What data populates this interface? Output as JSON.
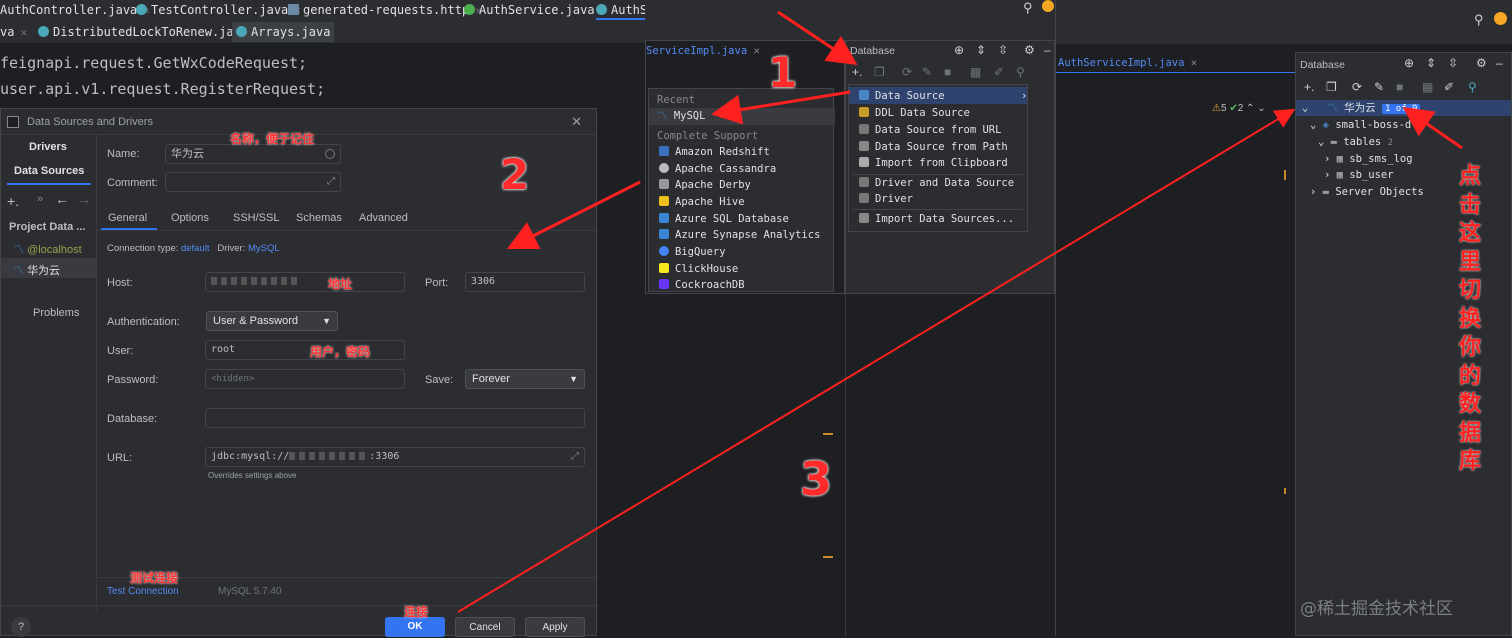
{
  "tabs_row1": [
    "AuthController.java",
    "TestController.java",
    "generated-requests.http",
    "AuthService.java",
    "AuthSe"
  ],
  "tabs_row2": [
    "va",
    "DistributedLockToRenew.java",
    "Arrays.java"
  ],
  "code_lines": [
    "feignapi.request.GetWxCodeRequest;",
    "user.api.v1.request.RegisterRequest;"
  ],
  "dialog": {
    "title": "Data Sources and Drivers",
    "side_tabs": [
      "Drivers",
      "Data Sources"
    ],
    "project_label": "Project Data ...",
    "sources": [
      "@localhost",
      "华为云"
    ],
    "problems": "Problems",
    "name_label": "Name:",
    "name_value": "华为云",
    "comment_label": "Comment:",
    "tabs": [
      "General",
      "Options",
      "SSH/SSL",
      "Schemas",
      "Advanced"
    ],
    "conn_type_label": "Connection type:",
    "conn_type": "default",
    "driver_label": "Driver:",
    "driver": "MySQL",
    "host_label": "Host:",
    "port_label": "Port:",
    "port": "3306",
    "auth_label": "Authentication:",
    "auth": "User & Password",
    "user_label": "User:",
    "user": "root",
    "password_label": "Password:",
    "password": "<hidden>",
    "save_label": "Save:",
    "save": "Forever",
    "database_label": "Database:",
    "url_label": "URL:",
    "url_prefix": "jdbc:mysql://",
    "url_suffix": ":3306",
    "url_note": "Overrides settings above",
    "test_connection": "Test Connection",
    "mysql_version": "MySQL 5.7.40",
    "ok": "OK",
    "cancel": "Cancel",
    "apply": "Apply",
    "help": "?"
  },
  "annotations": {
    "name": "名称，便于记住",
    "host": "地址",
    "user": "用户，密码",
    "test": "测试连接",
    "ok": "连接",
    "num1": "1",
    "num2": "2",
    "num3": "3",
    "vertical": [
      "点",
      "击",
      "这",
      "里",
      "切",
      "换",
      "你",
      "的",
      "数",
      "据",
      "库"
    ]
  },
  "mid_panel": {
    "editor_tab": "ServiceImpl.java",
    "recent_label": "Recent",
    "recent_item": "MySQL",
    "complete_label": "Complete Support",
    "items": [
      "Amazon Redshift",
      "Apache Cassandra",
      "Apache Derby",
      "Apache Hive",
      "Azure SQL Database",
      "Azure Synapse Analytics",
      "BigQuery",
      "ClickHouse",
      "CockroachDB"
    ],
    "db_title": "Database",
    "menu": [
      "Data Source",
      "DDL Data Source",
      "Data Source from URL",
      "Data Source from Path",
      "Import from Clipboard",
      "Driver and Data Source",
      "Driver",
      "Import Data Sources..."
    ]
  },
  "right_panel": {
    "editor_tab": "AuthServiceImpl.java",
    "warnings": "5",
    "checks": "2",
    "db_title": "Database",
    "root": "华为云",
    "root_badge": "1 of 9",
    "schema": "small-boss-d",
    "tables_label": "tables",
    "tables_count": "2",
    "tables": [
      "sb_sms_log",
      "sb_user"
    ],
    "server_objects": "Server Objects"
  },
  "watermark": "@稀土掘金技术社区"
}
